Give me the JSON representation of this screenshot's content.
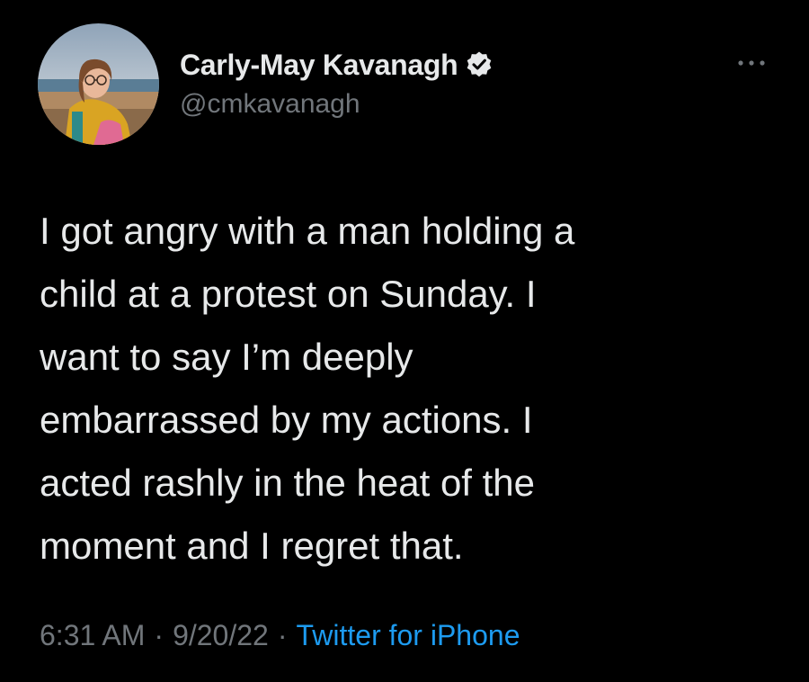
{
  "author": {
    "display_name": "Carly-May Kavanagh",
    "handle": "@cmkavanagh",
    "verified": true
  },
  "tweet": {
    "lines": [
      "I got angry with a man holding a",
      "child at a protest on Sunday. I",
      "want to say I’m deeply",
      "embarrassed by my actions. I",
      "acted rashly in the heat of the",
      "moment and I regret that."
    ],
    "time": "6:31 AM",
    "date": "9/20/22",
    "separator": "·",
    "source": "Twitter for iPhone"
  },
  "icons": {
    "verified": "verified-badge-icon",
    "more": "more-options-icon"
  },
  "colors": {
    "background": "#000000",
    "primary_text": "#e7e9ea",
    "secondary_text": "#71767b",
    "link": "#1d9bf0"
  }
}
